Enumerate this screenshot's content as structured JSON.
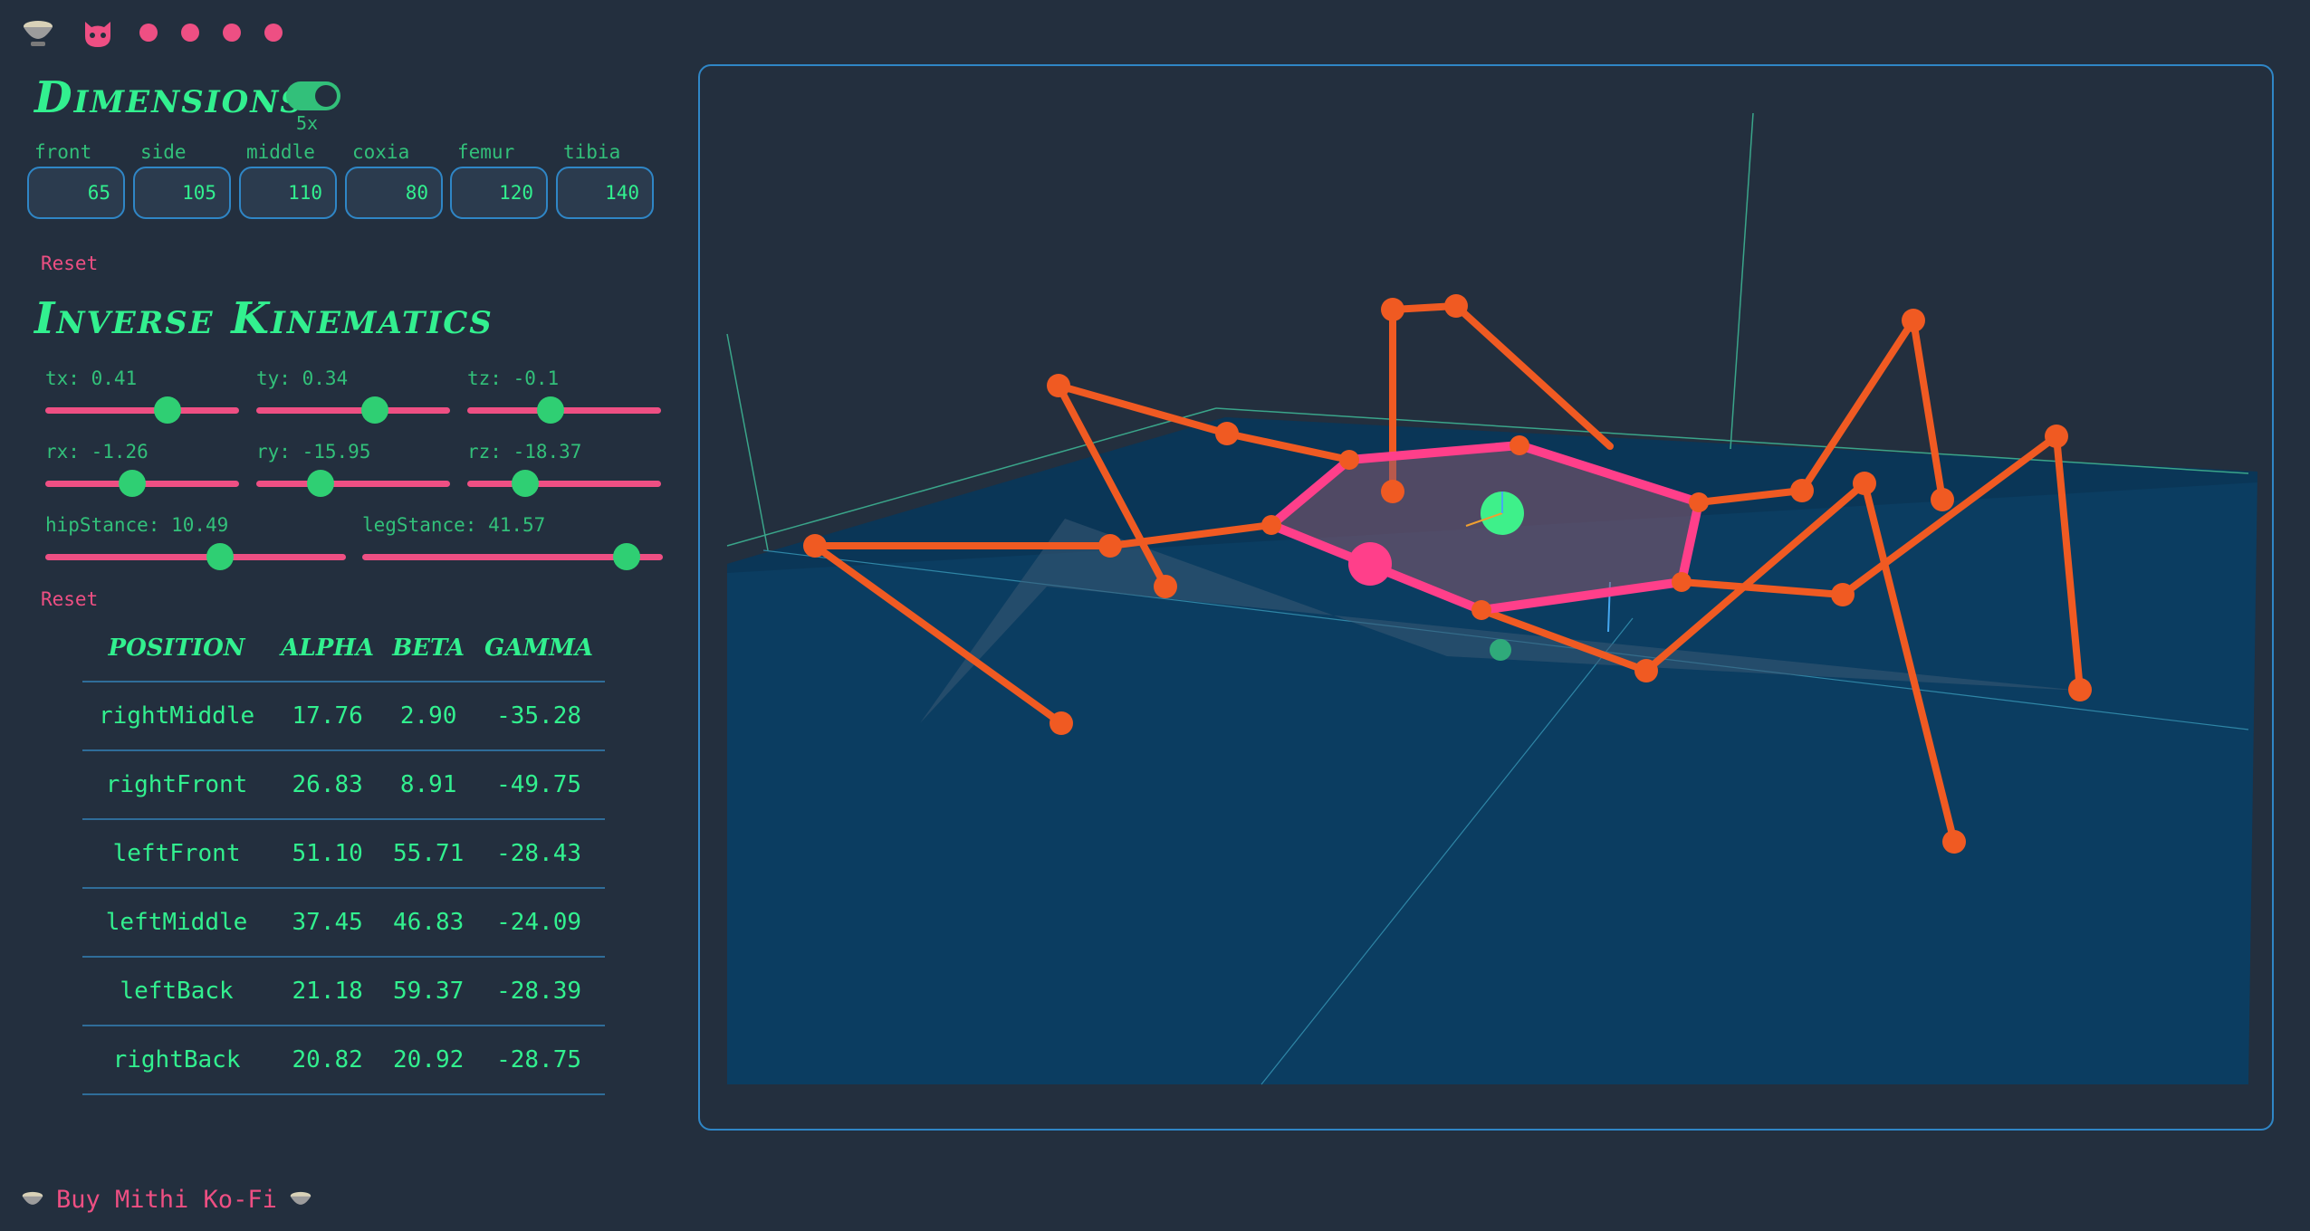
{
  "nav": {
    "items": [
      {
        "name": "home-bowl-icon"
      },
      {
        "name": "github-icon"
      },
      {
        "name": "nav-dot-1"
      },
      {
        "name": "nav-dot-2"
      },
      {
        "name": "nav-dot-3"
      },
      {
        "name": "nav-dot-4"
      }
    ]
  },
  "dimensions": {
    "title": "Dimensions",
    "toggle_label": "5x",
    "toggle_on": true,
    "fields": [
      {
        "label": "front",
        "value": "65"
      },
      {
        "label": "side",
        "value": "105"
      },
      {
        "label": "middle",
        "value": "110"
      },
      {
        "label": "coxia",
        "value": "80"
      },
      {
        "label": "femur",
        "value": "120"
      },
      {
        "label": "tibia",
        "value": "140"
      }
    ],
    "reset_label": "Reset"
  },
  "ik": {
    "title": "Inverse Kinematics",
    "sliders": [
      {
        "label": "tx: 0.41",
        "fraction": 0.63
      },
      {
        "label": "ty: 0.34",
        "fraction": 0.61
      },
      {
        "label": "tz: -0.1",
        "fraction": 0.43
      },
      {
        "label": "rx: -1.26",
        "fraction": 0.45
      },
      {
        "label": "ry: -15.95",
        "fraction": 0.33
      },
      {
        "label": "rz: -18.37",
        "fraction": 0.3
      },
      {
        "label": "hipStance: 10.49",
        "fraction": 0.58
      },
      {
        "label": "legStance: 41.57",
        "fraction": 0.88
      }
    ],
    "reset_label": "Reset"
  },
  "table": {
    "headers": [
      "Position",
      "Alpha",
      "Beta",
      "Gamma"
    ],
    "rows": [
      [
        "rightMiddle",
        "17.76",
        "2.90",
        "-35.28"
      ],
      [
        "rightFront",
        "26.83",
        "8.91",
        "-49.75"
      ],
      [
        "leftFront",
        "51.10",
        "55.71",
        "-28.43"
      ],
      [
        "leftMiddle",
        "37.45",
        "46.83",
        "-24.09"
      ],
      [
        "leftBack",
        "21.18",
        "59.37",
        "-28.39"
      ],
      [
        "rightBack",
        "20.82",
        "20.92",
        "-28.75"
      ]
    ]
  },
  "footer": {
    "label": "Buy Mithi Ko-Fi"
  },
  "colors": {
    "background": "#232f3e",
    "accent_green": "#32f08f",
    "accent_pink": "#ee4f83",
    "border_blue": "#2f86c6",
    "leg_orange": "#f05a22",
    "body_pink": "#ff3f8a",
    "ground_blue": "#0b3d61"
  }
}
